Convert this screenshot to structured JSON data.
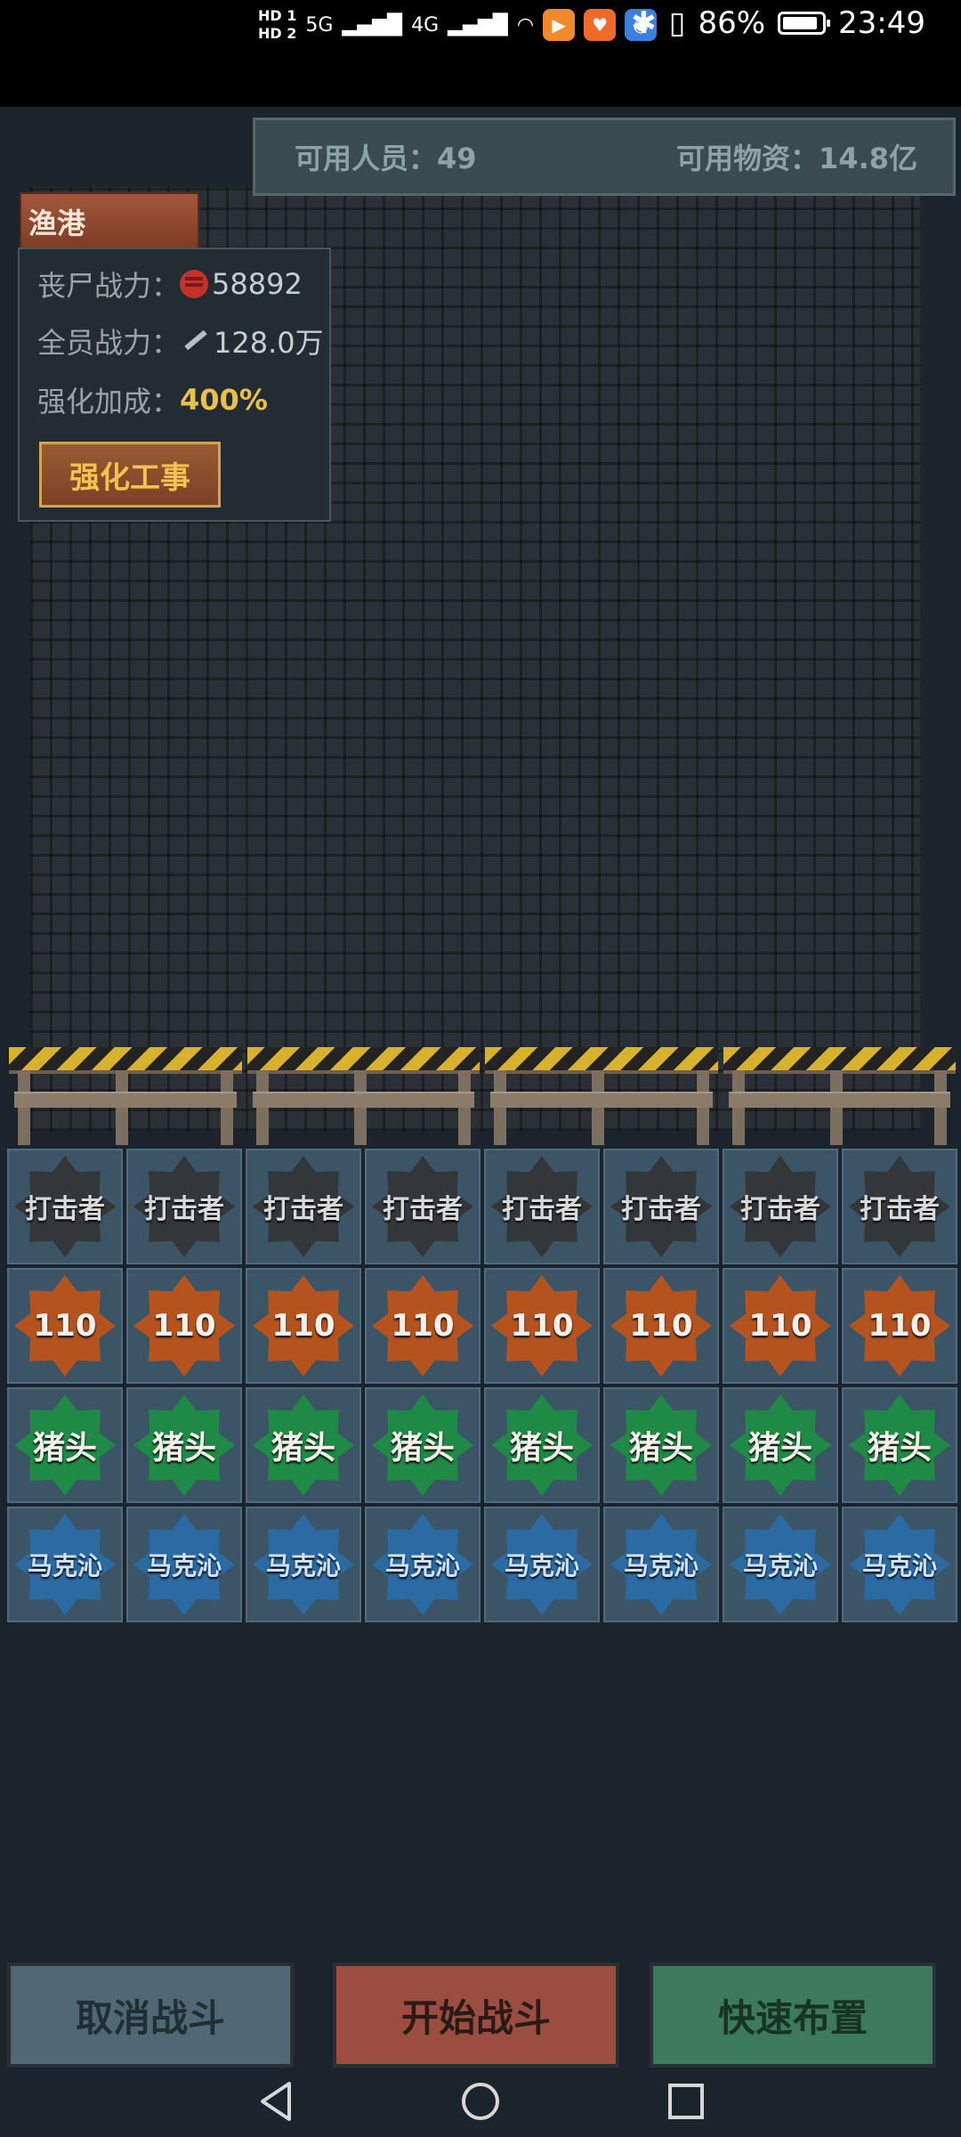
{
  "status_bar": {
    "hd1": "HD 1",
    "hd2": "HD 2",
    "net1": "5G",
    "net2": "4G",
    "battery_percent": "86%",
    "time": "23:49"
  },
  "resources": {
    "personnel": "可用人员：49",
    "supplies": "可用物资：14.8亿"
  },
  "region": {
    "name": "渔港"
  },
  "info": {
    "zombie_label": "丧尸战力：",
    "zombie_value": "58892",
    "team_label": "全员战力：",
    "team_value": "128.0万",
    "bonus_label": "强化加成：",
    "bonus_value": "400%",
    "strengthen_button": "强化工事"
  },
  "units": {
    "row1": [
      "打击者",
      "打击者",
      "打击者",
      "打击者",
      "打击者",
      "打击者",
      "打击者",
      "打击者"
    ],
    "row2": [
      "110",
      "110",
      "110",
      "110",
      "110",
      "110",
      "110",
      "110"
    ],
    "row3": [
      "猪头",
      "猪头",
      "猪头",
      "猪头",
      "猪头",
      "猪头",
      "猪头",
      "猪头"
    ],
    "row4": [
      "马克沁",
      "马克沁",
      "马克沁",
      "马克沁",
      "马克沁",
      "马克沁",
      "马克沁",
      "马克沁"
    ]
  },
  "actions": {
    "cancel": "取消战斗",
    "start": "开始战斗",
    "quick": "快速布置"
  },
  "colors": {
    "hitter": "#34373a",
    "cop": "#b4531e",
    "pig": "#1f8a46",
    "mark": "#2b6aa3",
    "accent_gold": "#e8c04a"
  }
}
